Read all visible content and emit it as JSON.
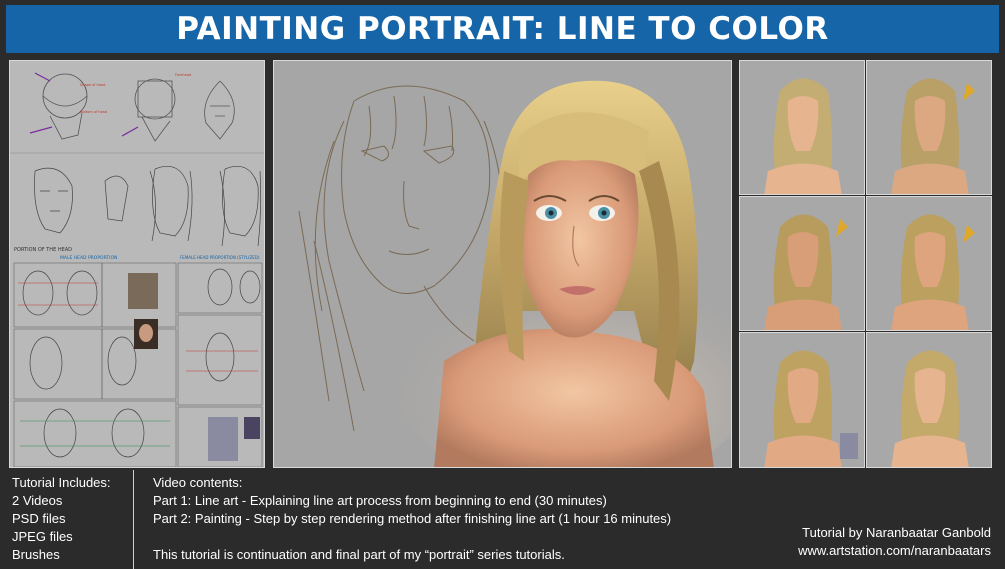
{
  "header": {
    "title": "PAINTING PORTRAIT: LINE TO COLOR"
  },
  "includes": {
    "heading": "Tutorial Includes:",
    "items": [
      "2 Videos",
      "PSD files",
      "JPEG files",
      "Brushes"
    ]
  },
  "video": {
    "heading": "Video contents:",
    "part1": "Part 1: Line art - Explaining line art process from beginning to end (30 minutes)",
    "part2": "Part 2: Painting - Step by step rendering method after finishing line art (1 hour 16 minutes)",
    "note": "This tutorial is continuation and final part of my “portrait” series tutorials."
  },
  "credit": {
    "author": "Tutorial by Naranbaatar Ganbold",
    "url": "www.artstation.com/naranbaatars"
  },
  "left_panel": {
    "section_label": "PORTION OF THE HEAD",
    "male_label": "MALE HEAD PROPORTION",
    "female_label": "FEMALE HEAD PROPORTION (STYLIZED)"
  },
  "colors": {
    "header": "#1565a8",
    "background": "#2b2b2b",
    "hair": "#c4ad72",
    "skin": "#e6b48e",
    "sketch": "#7a6a55"
  }
}
